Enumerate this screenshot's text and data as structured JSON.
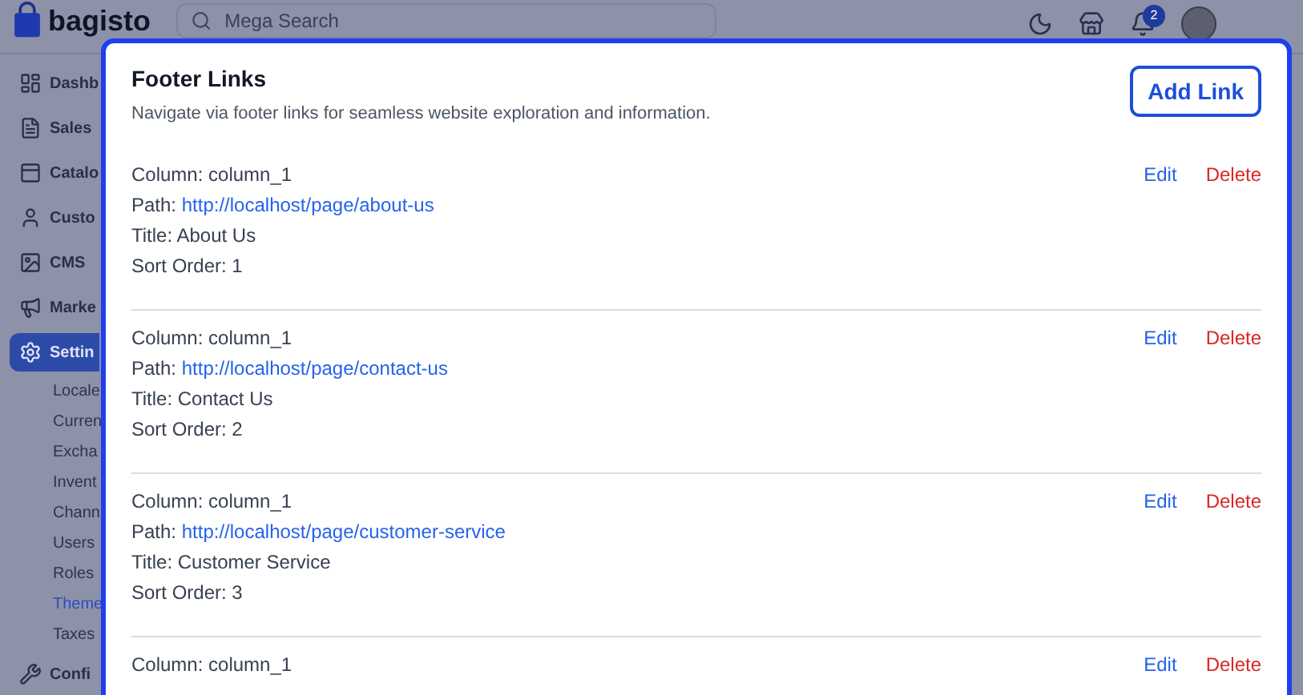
{
  "header": {
    "logo": "bagisto",
    "search": {
      "placeholder": "Mega Search"
    },
    "notification_count": "2"
  },
  "sidebar": {
    "items": [
      {
        "label": "Dashb",
        "selected": false
      },
      {
        "label": "Sales",
        "selected": false
      },
      {
        "label": "Catalo",
        "selected": false
      },
      {
        "label": "Custo",
        "selected": false
      },
      {
        "label": "CMS",
        "selected": false
      },
      {
        "label": "Marke",
        "selected": false
      },
      {
        "label": "Settin",
        "selected": true,
        "children": [
          {
            "label": "Locale",
            "selected": false
          },
          {
            "label": "Curren",
            "selected": false
          },
          {
            "label": "Excha",
            "selected": false
          },
          {
            "label": "Invent",
            "selected": false
          },
          {
            "label": "Chann",
            "selected": false
          },
          {
            "label": "Users",
            "selected": false
          },
          {
            "label": "Roles",
            "selected": false
          },
          {
            "label": "Theme",
            "selected": true
          },
          {
            "label": "Taxes",
            "selected": false
          }
        ]
      },
      {
        "label": "Confi",
        "selected": false
      }
    ]
  },
  "modal": {
    "title": "Footer Links",
    "subtitle": "Navigate via footer links for seamless website exploration and information.",
    "add_button": "Add Link",
    "entries": [
      {
        "column": "Column: column_1",
        "path_label": "Path:",
        "path": "http://localhost/page/about-us",
        "title": "Title: About Us",
        "sort_order": "Sort Order: 1",
        "edit": "Edit",
        "delete": "Delete"
      },
      {
        "column": "Column: column_1",
        "path_label": "Path:",
        "path": "http://localhost/page/contact-us",
        "title": "Title: Contact Us",
        "sort_order": "Sort Order: 2",
        "edit": "Edit",
        "delete": "Delete"
      },
      {
        "column": "Column: column_1",
        "path_label": "Path:",
        "path": "http://localhost/page/customer-service",
        "title": "Title: Customer Service",
        "sort_order": "Sort Order: 3",
        "edit": "Edit",
        "delete": "Delete"
      },
      {
        "column": "Column: column_1",
        "edit": "Edit",
        "delete": "Delete"
      }
    ]
  }
}
